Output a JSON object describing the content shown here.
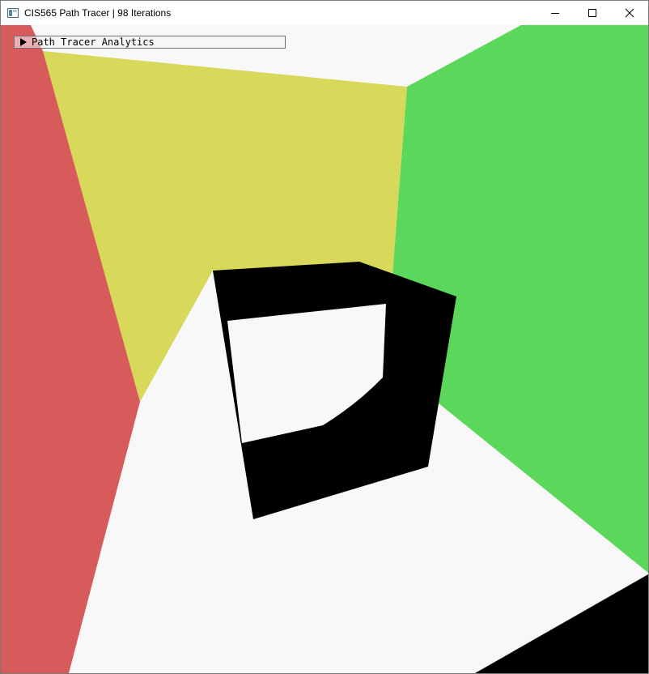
{
  "window": {
    "title": "CIS565 Path Tracer | 98 Iterations",
    "app_icon": "application-window-icon",
    "controls": [
      {
        "name": "minimize-button",
        "icon": "minimize-icon"
      },
      {
        "name": "maximize-button",
        "icon": "maximize-icon"
      },
      {
        "name": "close-button",
        "icon": "close-icon"
      }
    ]
  },
  "analytics_panel": {
    "label": "Path Tracer Analytics",
    "state": "collapsed",
    "arrow_icon": "triangle-right-icon"
  },
  "scene": {
    "colors": {
      "background_wall": "#f8f8f8",
      "floor": "#f8f8f8",
      "left_wall": "#d85b5b",
      "back_wall": "#d8d85b",
      "right_wall": "#5bd85b",
      "object": "#000000"
    }
  }
}
